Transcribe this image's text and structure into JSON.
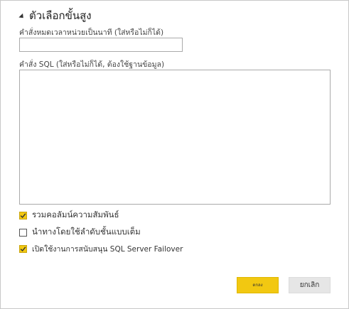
{
  "section": {
    "title": "ตัวเลือกขั้นสูง"
  },
  "timeout": {
    "label": "คำสั่งหมดเวลาหน่วยเป็นนาที (ใส่หรือไม่ก็ได้)",
    "value": ""
  },
  "sql": {
    "label": "คำสั่ง SQL (ใส่หรือไม่ก็ได้, ต้องใช้ฐานข้อมูล)",
    "value": ""
  },
  "options": [
    {
      "label": "รวมคอลัมน์ความสัมพันธ์",
      "checked": true
    },
    {
      "label": "นำทางโดยใช้ลำดับชั้นแบบเต็ม",
      "checked": false
    },
    {
      "label": "เปิดใช้งานการสนับสนุน SQL Server Failover",
      "checked": true
    }
  ],
  "buttons": {
    "ok_label": "ตกลง",
    "cancel_label": "ยกเลิก"
  },
  "colors": {
    "accent": "#f2c811",
    "border": "#aaaaaa",
    "cancel_bg": "#e6e6e6"
  }
}
